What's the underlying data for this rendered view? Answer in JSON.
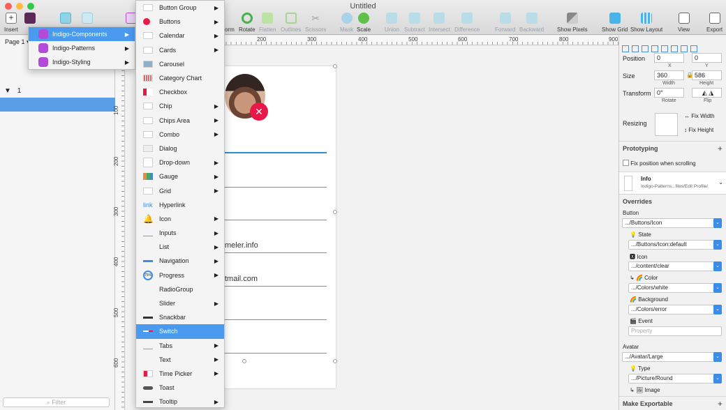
{
  "window": {
    "title": "Untitled"
  },
  "toolbar": {
    "insert": "Insert",
    "symbols_partial": "S",
    "form_partial": "orm",
    "rotate": "Rotate",
    "flatten": "Flatten",
    "outlines": "Outlines",
    "scissors": "Scissors",
    "mask": "Mask",
    "scale": "Scale",
    "union": "Union",
    "subtract": "Subtract",
    "intersect": "Intersect",
    "difference": "Difference",
    "forward": "Forward",
    "backward": "Backward",
    "show_pixels": "Show Pixels",
    "show_grid": "Show Grid",
    "show_layout": "Show Layout",
    "view": "View",
    "export": "Export"
  },
  "layers": {
    "page": "Page 1",
    "group_label": "1",
    "filter_placeholder": "Filter"
  },
  "ruler": {
    "top": [
      "200",
      "300",
      "400",
      "500",
      "600",
      "700",
      "800",
      "900"
    ],
    "left": [
      "100",
      "200",
      "300",
      "400",
      "500",
      "600"
    ]
  },
  "canvas": {
    "email_partial": "meler.info",
    "gmail_partial": "tmail.com",
    "clear_glyph": "✕"
  },
  "menu1": {
    "items": [
      {
        "label": "Indigo-Components",
        "selected": true
      },
      {
        "label": "Indigo-Patterns",
        "selected": false
      },
      {
        "label": "Indigo-Styling",
        "selected": false
      }
    ]
  },
  "menu2": {
    "items": [
      {
        "label": "Button Group",
        "sub": true
      },
      {
        "label": "Buttons",
        "sub": true
      },
      {
        "label": "Calendar",
        "sub": true
      },
      {
        "label": "Cards",
        "sub": true
      },
      {
        "label": "Carousel",
        "sub": false
      },
      {
        "label": "Category Chart",
        "sub": false
      },
      {
        "label": "Checkbox",
        "sub": false
      },
      {
        "label": "Chip",
        "sub": true
      },
      {
        "label": "Chips Area",
        "sub": true
      },
      {
        "label": "Combo",
        "sub": true
      },
      {
        "label": "Dialog",
        "sub": false
      },
      {
        "label": "Drop-down",
        "sub": true
      },
      {
        "label": "Gauge",
        "sub": true
      },
      {
        "label": "Grid",
        "sub": true
      },
      {
        "label": "Hyperlink",
        "sub": false,
        "thumb_text": "link"
      },
      {
        "label": "Icon",
        "sub": true
      },
      {
        "label": "Inputs",
        "sub": true
      },
      {
        "label": "List",
        "sub": true
      },
      {
        "label": "Navigation",
        "sub": true
      },
      {
        "label": "Progress",
        "sub": true,
        "thumb_text": "75%"
      },
      {
        "label": "RadioGroup",
        "sub": false
      },
      {
        "label": "Slider",
        "sub": true
      },
      {
        "label": "Snackbar",
        "sub": false
      },
      {
        "label": "Switch",
        "sub": false,
        "selected": true
      },
      {
        "label": "Tabs",
        "sub": true
      },
      {
        "label": "Text",
        "sub": true
      },
      {
        "label": "Time Picker",
        "sub": true
      },
      {
        "label": "Toast",
        "sub": false
      },
      {
        "label": "Tooltip",
        "sub": true
      }
    ]
  },
  "inspector": {
    "position_label": "Position",
    "x_value": "0",
    "y_value": "0",
    "x_cap": "X",
    "y_cap": "Y",
    "size_label": "Size",
    "width_value": "360",
    "height_value": "586",
    "width_cap": "Width",
    "height_cap": "Height",
    "transform_label": "Transform",
    "rotate_value": "0°",
    "rotate_cap": "Rotate",
    "flip_cap": "Flip",
    "resizing_label": "Resizing",
    "fix_width": "Fix Width",
    "fix_height": "Fix Height",
    "prototyping": "Prototyping",
    "fix_position": "Fix position when scrolling",
    "symbol_name": "Info",
    "symbol_path": "Indigo-Patterns...files/Edit Profile/",
    "overrides": "Overrides",
    "button_label": "Button",
    "button_value": ".../Buttons/Icon",
    "state_label": "State",
    "state_value": ".../Buttons/Icon:default",
    "icon_label": "Icon",
    "icon_value": ".../content/clear",
    "color_label": "Color",
    "color_value": ".../Colors/white",
    "background_label": "Background",
    "background_value": ".../Colors/error",
    "event_label": "Event",
    "property_placeholder": "Property",
    "avatar_label": "Avatar",
    "avatar_value": ".../Avatar/Large",
    "type_label": "Type",
    "type_value": ".../Picture/Round",
    "image_label": "Image",
    "make_exportable": "Make Exportable"
  },
  "colors": {
    "accent": "#4a9af0",
    "indigo_icon": "#b34ad9",
    "error": "#e8194a",
    "selected_layer": "#5a9ee8"
  }
}
